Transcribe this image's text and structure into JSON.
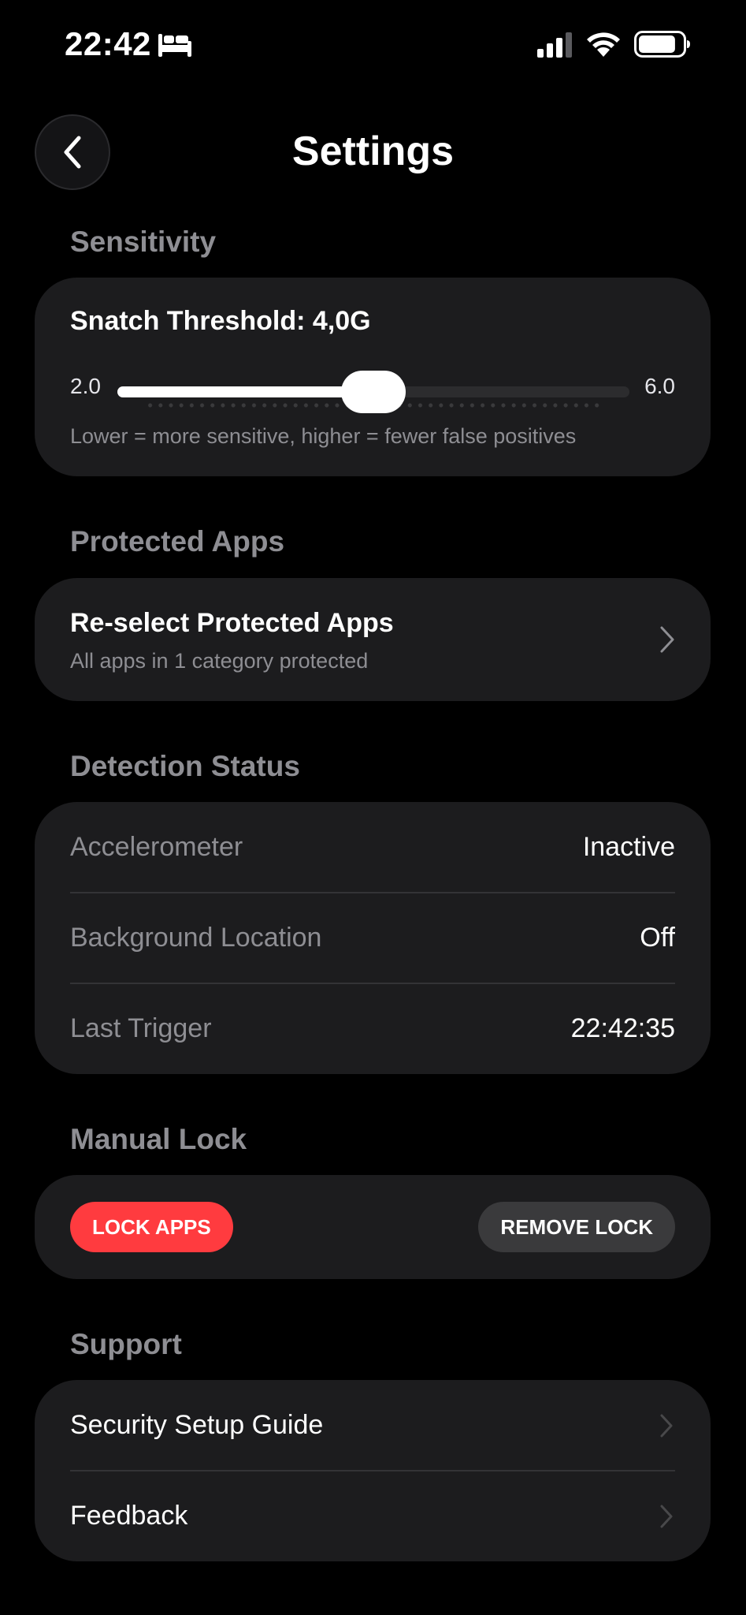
{
  "status_bar": {
    "time": "22:42",
    "battery_level": 0.85
  },
  "header": {
    "title": "Settings"
  },
  "sensitivity": {
    "section_label": "Sensitivity",
    "threshold_label": "Snatch Threshold: 4,0G",
    "min_label": "2.0",
    "max_label": "6.0",
    "min": 2.0,
    "max": 6.0,
    "value": 4.0,
    "hint": "Lower = more sensitive, higher = fewer false positives"
  },
  "protected_apps": {
    "section_label": "Protected Apps",
    "title": "Re-select Protected Apps",
    "subtitle": "All apps in 1 category protected"
  },
  "detection_status": {
    "section_label": "Detection Status",
    "rows": [
      {
        "label": "Accelerometer",
        "value": "Inactive"
      },
      {
        "label": "Background Location",
        "value": "Off"
      },
      {
        "label": "Last Trigger",
        "value": "22:42:35"
      }
    ]
  },
  "manual_lock": {
    "section_label": "Manual Lock",
    "lock_label": "LOCK APPS",
    "remove_label": "REMOVE LOCK",
    "lock_color": "#ff3b3f"
  },
  "support": {
    "section_label": "Support",
    "items": [
      {
        "label": "Security Setup Guide"
      },
      {
        "label": "Feedback"
      }
    ]
  }
}
